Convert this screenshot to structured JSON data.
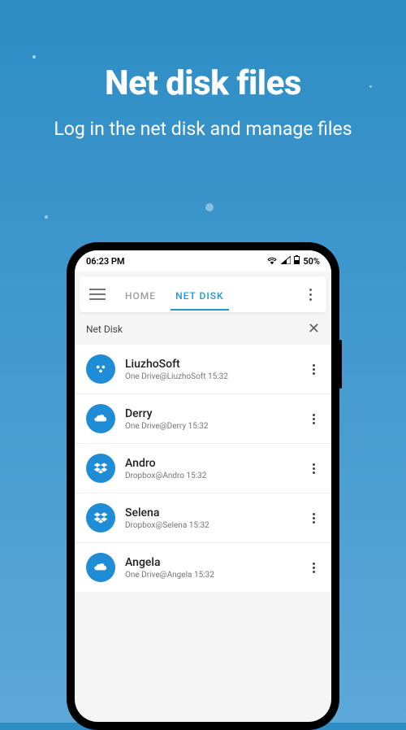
{
  "hero": {
    "title": "Net disk files",
    "subtitle": "Log in the net disk and manage files"
  },
  "status": {
    "time": "06:23 PM",
    "battery": "50%"
  },
  "topbar": {
    "tabs": [
      {
        "label": "HOME",
        "active": false
      },
      {
        "label": "NET DISK",
        "active": true
      }
    ]
  },
  "section": {
    "title": "Net Disk"
  },
  "items": [
    {
      "title": "LiuzhoSoft",
      "subtitle": "One Drive@LiuzhoSoft 15:32",
      "icon": "baidu"
    },
    {
      "title": "Derry",
      "subtitle": "One Drive@Derry 15:32",
      "icon": "onedrive"
    },
    {
      "title": "Andro",
      "subtitle": "Dropbox@Andro 15:32",
      "icon": "dropbox"
    },
    {
      "title": "Selena",
      "subtitle": "Dropbox@Selena 15:32",
      "icon": "dropbox"
    },
    {
      "title": "Angela",
      "subtitle": "One Drive@Angela 15:32",
      "icon": "onedrive"
    }
  ]
}
